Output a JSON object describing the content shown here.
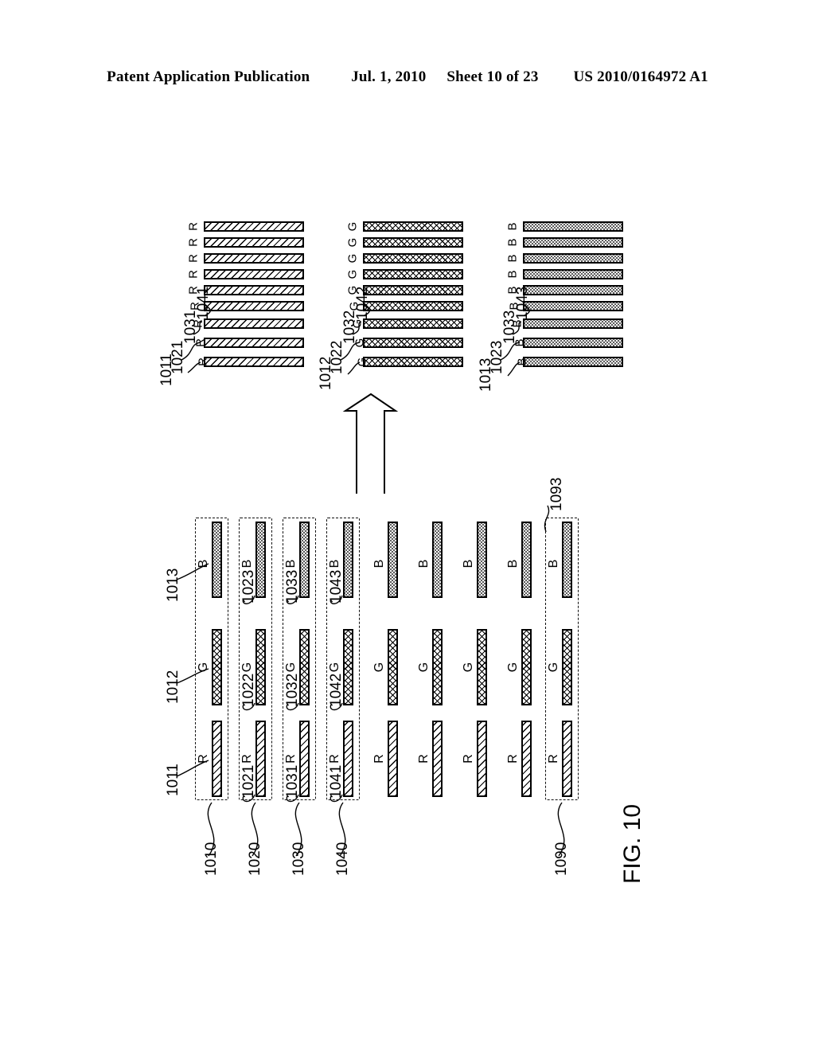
{
  "header": {
    "publication": "Patent Application Publication",
    "date": "Jul. 1, 2010",
    "sheet": "Sheet 10 of 23",
    "docnum": "US 2010/0164972 A1"
  },
  "figure": {
    "label": "FIG. 10",
    "arrow": "up-arrow",
    "colors": {
      "ink": "#000000",
      "paper": "#ffffff",
      "blue_fill": "#f2f2f2"
    }
  },
  "top_section": {
    "description": "Three separated color-plane groups of nine horizontal sub-pixel bars each",
    "groups": [
      {
        "id": "red-plane",
        "letter": "R",
        "pattern": "diagonal-hatch",
        "bar_count": 9,
        "letters": [
          "R",
          "R",
          "R",
          "R",
          "R",
          "R",
          "R",
          "R",
          "R"
        ],
        "refs": [
          "1011",
          "1021",
          "1031",
          "1041"
        ]
      },
      {
        "id": "green-plane",
        "letter": "G",
        "pattern": "cross-hatch",
        "bar_count": 9,
        "letters": [
          "G",
          "G",
          "G",
          "G",
          "G",
          "G",
          "G",
          "G",
          "G"
        ],
        "refs": [
          "1012",
          "1022",
          "1032",
          "1042"
        ]
      },
      {
        "id": "blue-plane",
        "letter": "B",
        "pattern": "stipple-dots",
        "bar_count": 9,
        "letters": [
          "B",
          "B",
          "B",
          "B",
          "B",
          "B",
          "B",
          "B",
          "B"
        ],
        "refs": [
          "1013",
          "1023",
          "1033",
          "1043"
        ]
      }
    ]
  },
  "bottom_section": {
    "description": "Nine pixel columns, each containing an R, G and B vertical sub-pixel bar",
    "row_letters": [
      "R",
      "G",
      "B"
    ],
    "column_count": 9,
    "columns": [
      {
        "index": 0,
        "boxed": true,
        "pixel_ref": "1010",
        "sub_refs": {
          "R": "1011",
          "G": "1012",
          "B": "1013"
        }
      },
      {
        "index": 1,
        "boxed": true,
        "pixel_ref": "1020",
        "sub_refs": {
          "R": "1021",
          "G": "1022",
          "B": "1023"
        }
      },
      {
        "index": 2,
        "boxed": true,
        "pixel_ref": "1030",
        "sub_refs": {
          "R": "1031",
          "G": "1032",
          "B": "1033"
        }
      },
      {
        "index": 3,
        "boxed": true,
        "pixel_ref": "1040",
        "sub_refs": {
          "R": "1041",
          "G": "1042",
          "B": "1043"
        }
      },
      {
        "index": 4,
        "boxed": false,
        "pixel_ref": "",
        "sub_refs": {
          "R": "",
          "G": "",
          "B": ""
        }
      },
      {
        "index": 5,
        "boxed": false,
        "pixel_ref": "",
        "sub_refs": {
          "R": "",
          "G": "",
          "B": ""
        }
      },
      {
        "index": 6,
        "boxed": false,
        "pixel_ref": "",
        "sub_refs": {
          "R": "",
          "G": "",
          "B": ""
        }
      },
      {
        "index": 7,
        "boxed": false,
        "pixel_ref": "",
        "sub_refs": {
          "R": "",
          "G": "",
          "B": ""
        }
      },
      {
        "index": 8,
        "boxed": true,
        "pixel_ref": "1090",
        "sub_refs": {
          "R": "",
          "G": "",
          "B": "1093"
        }
      }
    ]
  },
  "reference_numerals": {
    "top_red": {
      "a": "1011",
      "b": "1021",
      "c": "1031",
      "d": "1041"
    },
    "top_green": {
      "a": "1012",
      "b": "1022",
      "c": "1032",
      "d": "1042"
    },
    "top_blue": {
      "a": "1013",
      "b": "1023",
      "c": "1033",
      "d": "1043"
    },
    "bottom_sub": {
      "c0": {
        "R": "1011",
        "G": "1012",
        "B": "1013"
      },
      "c1": {
        "R": "1021",
        "G": "1022",
        "B": "1023"
      },
      "c2": {
        "R": "1031",
        "G": "1032",
        "B": "1033"
      },
      "c3": {
        "R": "1041",
        "G": "1042",
        "B": "1043"
      },
      "c8": {
        "B": "1093"
      }
    },
    "bottom_pixels": {
      "p0": "1010",
      "p1": "1020",
      "p2": "1030",
      "p3": "1040",
      "p8": "1090"
    }
  }
}
